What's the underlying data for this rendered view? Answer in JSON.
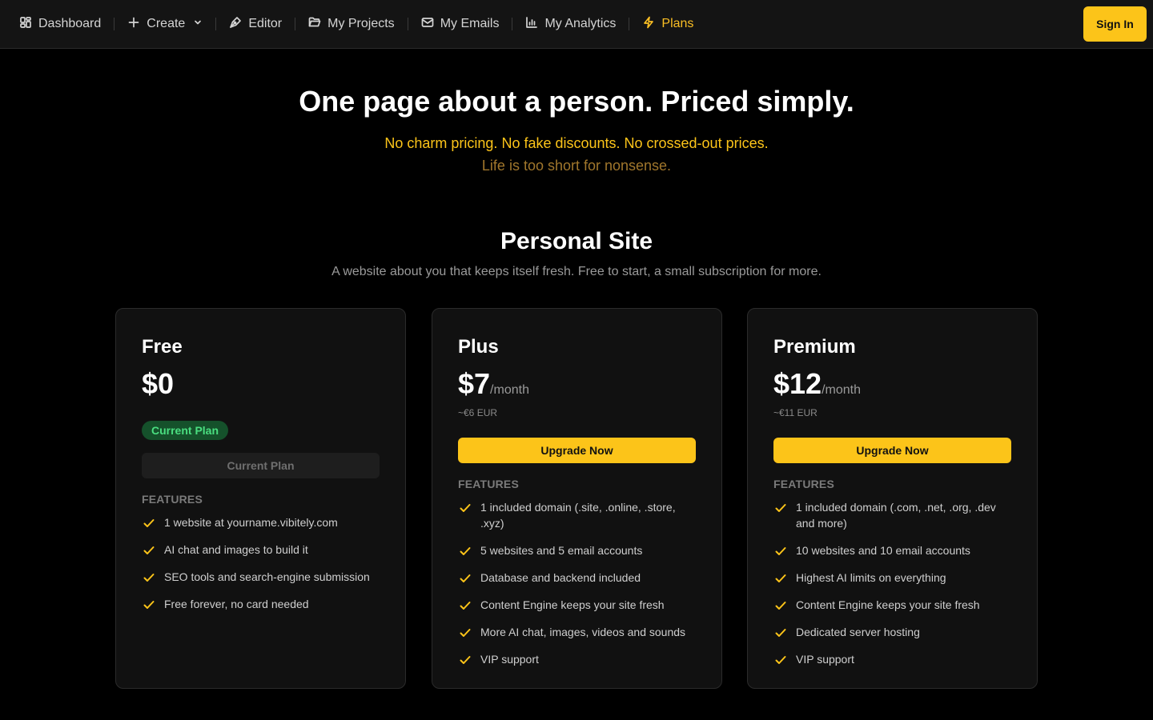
{
  "nav": {
    "items": [
      {
        "label": "Dashboard",
        "icon": "dashboard-icon"
      },
      {
        "label": "Create",
        "icon": "plus-icon"
      },
      {
        "label": "Editor",
        "icon": "pen-icon"
      },
      {
        "label": "My Projects",
        "icon": "folder-icon"
      },
      {
        "label": "My Emails",
        "icon": "mail-icon"
      },
      {
        "label": "My Analytics",
        "icon": "bar-chart-icon"
      },
      {
        "label": "Plans",
        "icon": "lightning-icon"
      }
    ],
    "sign_in": "Sign In",
    "accent_color": "#fcc419"
  },
  "hero": {
    "title": "One page about a person. Priced simply.",
    "subtitle1": "No charm pricing. No fake discounts. No crossed-out prices.",
    "subtitle2": "Life is too short for nonsense."
  },
  "section": {
    "title": "Personal Site",
    "subtitle": "A website about you that keeps itself fresh. Free to start, a small subscription for more."
  },
  "plans": [
    {
      "name": "Free",
      "price": "$0",
      "badge": "Current Plan",
      "button": "Current Plan",
      "features_label": "FEATURES",
      "features": [
        "1 website at yourname.vibitely.com",
        "AI chat and images to build it",
        "SEO tools and search-engine submission",
        "Free forever, no card needed"
      ]
    },
    {
      "name": "Plus",
      "price": "$7",
      "period": "/month",
      "eur": "~€6 EUR",
      "button": "Upgrade Now",
      "features_label": "FEATURES",
      "features": [
        "1 included domain (.site, .online, .store, .xyz)",
        "5 websites and 5 email accounts",
        "Database and backend included",
        "Content Engine keeps your site fresh",
        "More AI chat, images, videos and sounds",
        "VIP support"
      ]
    },
    {
      "name": "Premium",
      "price": "$12",
      "period": "/month",
      "eur": "~€11 EUR",
      "button": "Upgrade Now",
      "features_label": "FEATURES",
      "features": [
        "1 included domain (.com, .net, .org, .dev and more)",
        "10 websites and 10 email accounts",
        "Highest AI limits on everything",
        "Content Engine keeps your site fresh",
        "Dedicated server hosting",
        "VIP support"
      ]
    }
  ]
}
